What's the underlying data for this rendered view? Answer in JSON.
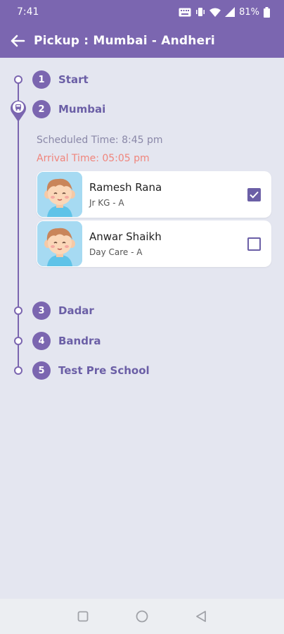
{
  "status_bar": {
    "time": "7:41",
    "battery": "81%",
    "icons": [
      "keyboard-icon",
      "vibrate-icon",
      "wifi-icon",
      "signal-icon",
      "battery-icon"
    ]
  },
  "app_bar": {
    "title": "Pickup : Mumbai - Andheri",
    "background_color": "#7b66b0"
  },
  "stops": [
    {
      "number": "1",
      "name": "Start"
    },
    {
      "number": "2",
      "name": "Mumbai"
    },
    {
      "number": "3",
      "name": "Dadar"
    },
    {
      "number": "4",
      "name": "Bandra"
    },
    {
      "number": "5",
      "name": "Test Pre School"
    }
  ],
  "current_stop": {
    "scheduled_time": "Scheduled Time: 8:45 pm",
    "arrival_time": "Arrival Time: 05:05 pm"
  },
  "students": [
    {
      "name": "Ramesh Rana",
      "class": "Jr KG - A",
      "checked": true
    },
    {
      "name": "Anwar Shaikh",
      "class": "Day Care - A",
      "checked": false
    }
  ],
  "colors": {
    "accent": "#7b66b0",
    "stop_text": "#6b5fa6",
    "arrival": "#f0857c",
    "avatar_bg": "#a6daf2"
  }
}
